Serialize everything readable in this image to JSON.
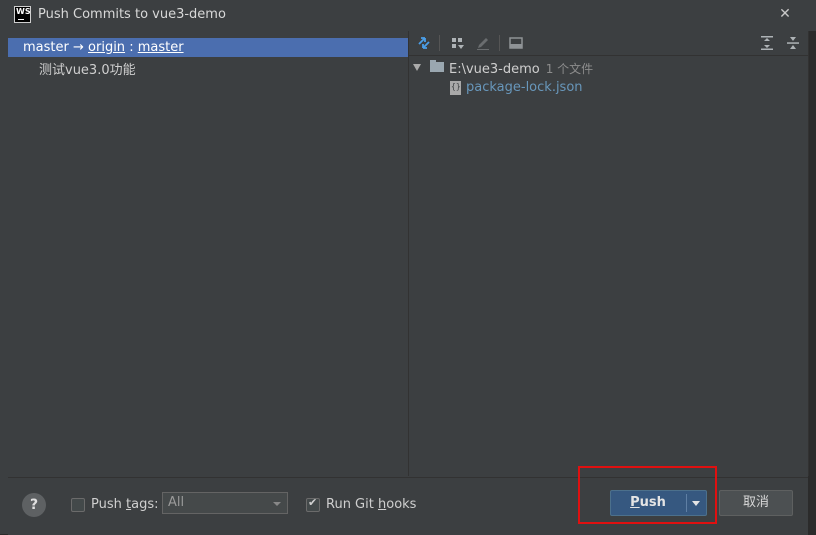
{
  "window": {
    "title": "Push Commits to vue3-demo"
  },
  "commits": {
    "branch": {
      "local": "master",
      "arrow": "→",
      "remote": "origin",
      "sep": ":",
      "remote_branch": "master"
    },
    "items": [
      {
        "message": "测试vue3.0功能"
      }
    ]
  },
  "changes": {
    "folder": {
      "path": "E:\\vue3-demo",
      "count": "1 个文件"
    },
    "files": [
      {
        "name": "package-lock.json"
      }
    ]
  },
  "footer": {
    "help": "?",
    "push_tags_label": {
      "pre": "Push ",
      "ul": "t",
      "post": "ags:"
    },
    "push_tags_checked": false,
    "tags_select": "All",
    "run_hooks_label": {
      "pre": "Run Git ",
      "ul": "h",
      "post": "ooks"
    },
    "run_hooks_checked": true,
    "push_button": {
      "ul": "P",
      "post": "ush"
    },
    "cancel_button": "取消"
  },
  "colors": {
    "selection": "#4b6eaf",
    "push": "#365880",
    "highlight": "#e01010",
    "file_link": "#6897bb"
  }
}
